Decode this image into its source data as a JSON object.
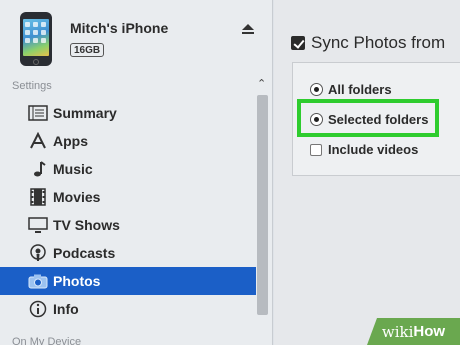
{
  "device": {
    "name": "Mitch's iPhone",
    "capacity": "16GB"
  },
  "sidebar": {
    "section_label": "Settings",
    "items": [
      {
        "label": "Summary",
        "icon": "summary-icon"
      },
      {
        "label": "Apps",
        "icon": "apps-icon"
      },
      {
        "label": "Music",
        "icon": "music-note-icon"
      },
      {
        "label": "Movies",
        "icon": "film-icon"
      },
      {
        "label": "TV Shows",
        "icon": "tv-icon"
      },
      {
        "label": "Podcasts",
        "icon": "podcast-icon"
      },
      {
        "label": "Photos",
        "icon": "camera-icon",
        "selected": true
      },
      {
        "label": "Info",
        "icon": "info-icon"
      }
    ],
    "footer_label": "On My Device"
  },
  "main": {
    "sync_label": "Sync Photos from",
    "sync_checked": true,
    "options": {
      "all_folders": "All folders",
      "selected_folders": "Selected folders",
      "include_videos": "Include videos"
    },
    "selected_option": "Selected folders"
  },
  "watermark": {
    "prefix": "wiki",
    "suffix": "How"
  },
  "colors": {
    "selection": "#1b5fc7",
    "highlight": "#2ecc2e",
    "watermark": "#6aa84f"
  }
}
